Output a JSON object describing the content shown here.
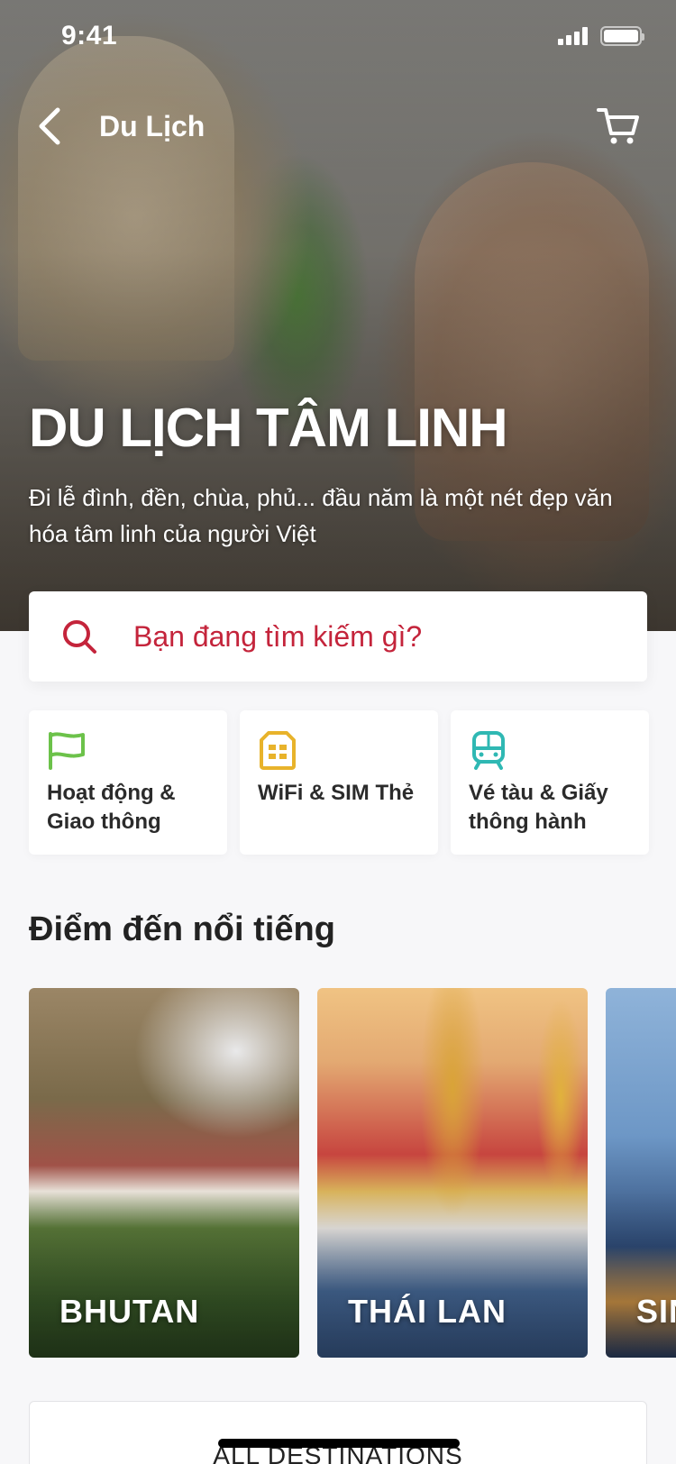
{
  "status_bar": {
    "time": "9:41"
  },
  "nav": {
    "title": "Du Lịch"
  },
  "hero": {
    "title": "DU LỊCH TÂM LINH",
    "subtitle": "Đi lễ đình, đền, chùa, phủ... đầu năm là một nét đẹp văn hóa tâm linh của người Việt"
  },
  "search": {
    "placeholder": "Bạn đang tìm kiếm gì?"
  },
  "categories": [
    {
      "icon": "flag-icon",
      "label": "Hoạt động & Giao thông",
      "color": "#6cc24a"
    },
    {
      "icon": "sim-card-icon",
      "label": "WiFi & SIM Thẻ",
      "color": "#e8b32b"
    },
    {
      "icon": "train-icon",
      "label": "Vé tàu & Giấy thông hành",
      "color": "#2fb8b3"
    }
  ],
  "destinations": {
    "title": "Điểm đến nổi tiếng",
    "items": [
      {
        "name": "BHUTAN"
      },
      {
        "name": "THÁI LAN"
      },
      {
        "name": "SINGAPORE"
      }
    ],
    "all_label": "ALL DESTINATIONS"
  },
  "colors": {
    "accent": "#c4243b",
    "background": "#f7f7f9"
  }
}
